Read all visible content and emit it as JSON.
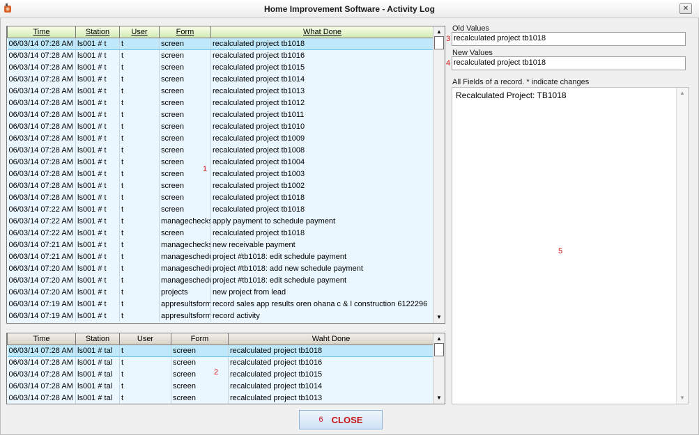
{
  "window": {
    "title": "Home Improvement Software - Activity Log",
    "close_glyph": "✕"
  },
  "grid1": {
    "columns": [
      "Time",
      "Station",
      "User",
      "Form",
      "What Done"
    ],
    "marker": "1",
    "rows": [
      [
        "06/03/14 07:28 AM",
        "ls001 # t",
        "t",
        "screen",
        "recalculated project tb1018"
      ],
      [
        "06/03/14 07:28 AM",
        "ls001 # t",
        "t",
        "screen",
        "recalculated project tb1016"
      ],
      [
        "06/03/14 07:28 AM",
        "ls001 # t",
        "t",
        "screen",
        "recalculated project tb1015"
      ],
      [
        "06/03/14 07:28 AM",
        "ls001 # t",
        "t",
        "screen",
        "recalculated project tb1014"
      ],
      [
        "06/03/14 07:28 AM",
        "ls001 # t",
        "t",
        "screen",
        "recalculated project tb1013"
      ],
      [
        "06/03/14 07:28 AM",
        "ls001 # t",
        "t",
        "screen",
        "recalculated project tb1012"
      ],
      [
        "06/03/14 07:28 AM",
        "ls001 # t",
        "t",
        "screen",
        "recalculated project tb1011"
      ],
      [
        "06/03/14 07:28 AM",
        "ls001 # t",
        "t",
        "screen",
        "recalculated project tb1010"
      ],
      [
        "06/03/14 07:28 AM",
        "ls001 # t",
        "t",
        "screen",
        "recalculated project tb1009"
      ],
      [
        "06/03/14 07:28 AM",
        "ls001 # t",
        "t",
        "screen",
        "recalculated project tb1008"
      ],
      [
        "06/03/14 07:28 AM",
        "ls001 # t",
        "t",
        "screen",
        "recalculated project tb1004"
      ],
      [
        "06/03/14 07:28 AM",
        "ls001 # t",
        "t",
        "screen",
        "recalculated project tb1003"
      ],
      [
        "06/03/14 07:28 AM",
        "ls001 # t",
        "t",
        "screen",
        "recalculated project tb1002"
      ],
      [
        "06/03/14 07:28 AM",
        "ls001 # t",
        "t",
        "screen",
        "recalculated project tb1018"
      ],
      [
        "06/03/14 07:22 AM",
        "ls001 # t",
        "t",
        "screen",
        "recalculated project tb1018"
      ],
      [
        "06/03/14 07:22 AM",
        "ls001 # t",
        "t",
        "managechecks",
        "apply payment to schedule payment"
      ],
      [
        "06/03/14 07:22 AM",
        "ls001 # t",
        "t",
        "screen",
        "recalculated project tb1018"
      ],
      [
        "06/03/14 07:21 AM",
        "ls001 # t",
        "t",
        "managechecks",
        "new receivable payment"
      ],
      [
        "06/03/14 07:21 AM",
        "ls001 # t",
        "t",
        "manageschedu",
        "project #tb1018: edit schedule payment"
      ],
      [
        "06/03/14 07:20 AM",
        "ls001 # t",
        "t",
        "manageschedu",
        "project #tb1018: add new schedule payment"
      ],
      [
        "06/03/14 07:20 AM",
        "ls001 # t",
        "t",
        "manageschedu",
        "project #tb1018: edit schedule payment"
      ],
      [
        "06/03/14 07:20 AM",
        "ls001 # t",
        "t",
        "projects",
        "new project from lead"
      ],
      [
        "06/03/14 07:19 AM",
        "ls001 # t",
        "t",
        "appresultsform",
        "record sales app results oren ohana c & l construction 6122296"
      ],
      [
        "06/03/14 07:19 AM",
        "ls001 # t",
        "t",
        "appresultsform",
        "record activity"
      ]
    ]
  },
  "grid2": {
    "columns": [
      "Time",
      "Station",
      "User",
      "Form",
      "Waht Done"
    ],
    "marker": "2",
    "rows": [
      [
        "06/03/14 07:28 AM",
        "ls001 # tal",
        "t",
        "screen",
        "recalculated project tb1018"
      ],
      [
        "06/03/14 07:28 AM",
        "ls001 # tal",
        "t",
        "screen",
        "recalculated project tb1016"
      ],
      [
        "06/03/14 07:28 AM",
        "ls001 # tal",
        "t",
        "screen",
        "recalculated project tb1015"
      ],
      [
        "06/03/14 07:28 AM",
        "ls001 # tal",
        "t",
        "screen",
        "recalculated project tb1014"
      ],
      [
        "06/03/14 07:28 AM",
        "ls001 # tal",
        "t",
        "screen",
        "recalculated project tb1013"
      ]
    ]
  },
  "old_values": {
    "label": "Old Values",
    "value": "recalculated project tb1018",
    "marker": "3"
  },
  "new_values": {
    "label": "New Values",
    "value": "recalculated project tb1018",
    "marker": "4"
  },
  "all_fields": {
    "label": "All Fields of a record. * indicate changes",
    "text": "Recalculated Project: TB1018",
    "marker": "5"
  },
  "close_button": {
    "label": "CLOSE",
    "marker": "6"
  },
  "scroll": {
    "up": "▲",
    "down": "▼"
  },
  "colors": {
    "selected_row": "#bfe9fb",
    "grid_bg": "#eaf7ff",
    "close_text": "#c41717"
  },
  "icons": {
    "app": "app-icon",
    "window_close": "close-icon"
  }
}
